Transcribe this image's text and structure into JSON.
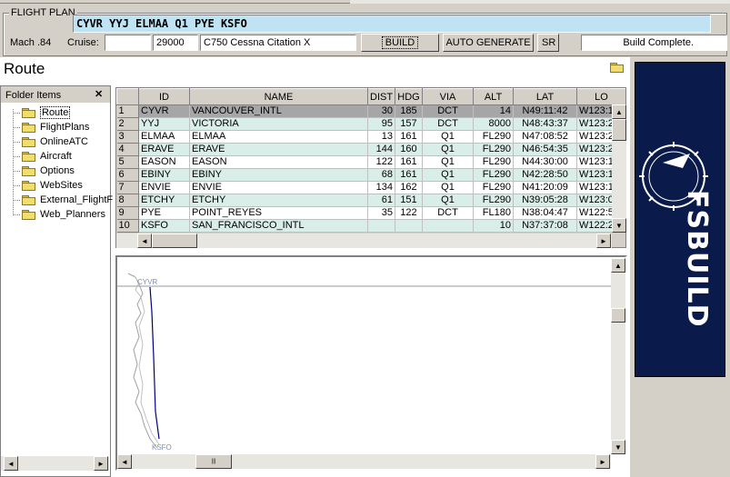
{
  "flight_plan": {
    "group_label": "FLIGHT PLAN",
    "route_string": "CYVR YYJ ELMAA Q1 PYE KSFO",
    "mach_label": "Mach .84",
    "cruise_label": "Cruise:",
    "cruise_value": "",
    "altitude": "29000",
    "aircraft": "C750 Cessna Citation X",
    "build_label": "BUILD",
    "auto_generate_label": "AUTO GENERATE",
    "sr_label": "SR",
    "status": "Build Complete."
  },
  "page_title": "Route",
  "folder_panel": {
    "title": "Folder Items",
    "close_glyph": "✕",
    "items": [
      "Route",
      "FlightPlans",
      "OnlineATC",
      "Aircraft",
      "Options",
      "WebSites",
      "External_FlightF",
      "Web_Planners"
    ]
  },
  "grid": {
    "columns": [
      "ID",
      "NAME",
      "DIST",
      "HDG",
      "VIA",
      "ALT",
      "LAT",
      "LO"
    ],
    "rows": [
      {
        "n": "1",
        "id": "CYVR",
        "name": "VANCOUVER_INTL",
        "dist": "30",
        "hdg": "185",
        "via": "DCT",
        "alt": "14",
        "lat": "N49:11:42",
        "lon": "W123:1"
      },
      {
        "n": "2",
        "id": "YYJ",
        "name": "VICTORIA",
        "dist": "95",
        "hdg": "157",
        "via": "DCT",
        "alt": "8000",
        "lat": "N48:43:37",
        "lon": "W123:2"
      },
      {
        "n": "3",
        "id": "ELMAA",
        "name": "ELMAA",
        "dist": "13",
        "hdg": "161",
        "via": "Q1",
        "alt": "FL290",
        "lat": "N47:08:52",
        "lon": "W123:2"
      },
      {
        "n": "4",
        "id": "ERAVE",
        "name": "ERAVE",
        "dist": "144",
        "hdg": "160",
        "via": "Q1",
        "alt": "FL290",
        "lat": "N46:54:35",
        "lon": "W123:2"
      },
      {
        "n": "5",
        "id": "EASON",
        "name": "EASON",
        "dist": "122",
        "hdg": "161",
        "via": "Q1",
        "alt": "FL290",
        "lat": "N44:30:00",
        "lon": "W123:1"
      },
      {
        "n": "6",
        "id": "EBINY",
        "name": "EBINY",
        "dist": "68",
        "hdg": "161",
        "via": "Q1",
        "alt": "FL290",
        "lat": "N42:28:50",
        "lon": "W123:1"
      },
      {
        "n": "7",
        "id": "ENVIE",
        "name": "ENVIE",
        "dist": "134",
        "hdg": "162",
        "via": "Q1",
        "alt": "FL290",
        "lat": "N41:20:09",
        "lon": "W123:1"
      },
      {
        "n": "8",
        "id": "ETCHY",
        "name": "ETCHY",
        "dist": "61",
        "hdg": "151",
        "via": "Q1",
        "alt": "FL290",
        "lat": "N39:05:28",
        "lon": "W123:0"
      },
      {
        "n": "9",
        "id": "PYE",
        "name": "POINT_REYES",
        "dist": "35",
        "hdg": "122",
        "via": "DCT",
        "alt": "FL180",
        "lat": "N38:04:47",
        "lon": "W122:5"
      },
      {
        "n": "10",
        "id": "KSFO",
        "name": "SAN_FRANCISCO_INTL",
        "dist": "",
        "hdg": "",
        "via": "",
        "alt": "10",
        "lat": "N37:37:08",
        "lon": "W122:2"
      }
    ]
  },
  "map": {
    "origin_label": "CYVR",
    "dest_label": "KSFO"
  },
  "logo": {
    "text": "FSBUILD",
    "bg": "#0a1a4a"
  },
  "icons": {
    "scroll_up": "▲",
    "scroll_down": "▼",
    "scroll_left": "◄",
    "scroll_right": "►",
    "grip": "|||"
  }
}
